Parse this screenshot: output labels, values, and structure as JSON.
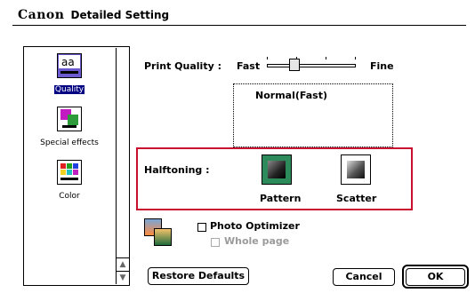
{
  "header": {
    "brand": "Canon",
    "title": "Detailed Setting"
  },
  "sidebar": {
    "items": [
      {
        "label": "Quality",
        "icon": "quality-icon",
        "selected": true
      },
      {
        "label": "Special effects",
        "icon": "special-effects-icon",
        "selected": false
      },
      {
        "label": "Color",
        "icon": "color-icon",
        "selected": false
      }
    ],
    "scroll_up": "▲",
    "scroll_down": "▼"
  },
  "print_quality": {
    "label": "Print Quality :",
    "min_label": "Fast",
    "max_label": "Fine",
    "level": 0.25,
    "description": "Normal(Fast)"
  },
  "halftoning": {
    "label": "Halftoning :",
    "options": [
      {
        "label": "Pattern",
        "selected": true,
        "icon": "pattern-icon"
      },
      {
        "label": "Scatter",
        "selected": false,
        "icon": "scatter-icon"
      }
    ]
  },
  "photo_optimizer": {
    "label": "Photo Optimizer",
    "checked": false,
    "whole_page_label": "Whole page",
    "whole_page_checked": false,
    "icon": "photo-optimizer-icon"
  },
  "buttons": {
    "restore_defaults": "Restore Defaults",
    "cancel": "Cancel",
    "ok": "OK"
  },
  "colors": {
    "halftone_border": "#c8102e",
    "selection": "#000080",
    "pattern_icon_bg": "#2d8a5a"
  }
}
